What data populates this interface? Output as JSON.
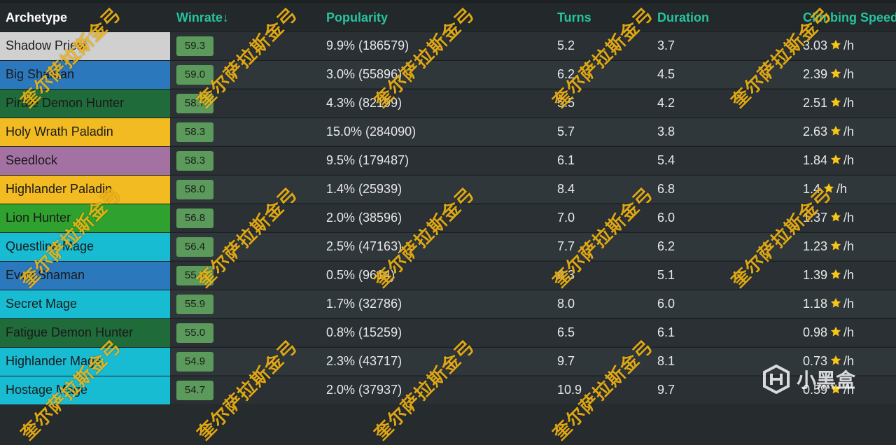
{
  "header": {
    "archetype": "Archetype",
    "winrate": "Winrate↓",
    "popularity": "Popularity",
    "turns": "Turns",
    "duration": "Duration",
    "climbing_speed": "Climbing Speed"
  },
  "rows": [
    {
      "name": "Shadow Priest",
      "color": "#d0d0d0",
      "winrate": "59.3",
      "popularity": "9.9% (186579)",
      "turns": "5.2",
      "duration": "3.7",
      "speed": "3.03",
      "unit": "/h"
    },
    {
      "name": "Big Shaman",
      "color": "#2b78bd",
      "winrate": "59.0",
      "popularity": "3.0% (55896)",
      "turns": "6.2",
      "duration": "4.5",
      "speed": "2.39",
      "unit": "/h"
    },
    {
      "name": "Pirate Demon Hunter",
      "color": "#1f6b3a",
      "winrate": "58.7",
      "popularity": "4.3% (82199)",
      "turns": "5.5",
      "duration": "4.2",
      "speed": "2.51",
      "unit": "/h"
    },
    {
      "name": "Holy Wrath Paladin",
      "color": "#f2bb22",
      "winrate": "58.3",
      "popularity": "15.0% (284090)",
      "turns": "5.7",
      "duration": "3.8",
      "speed": "2.63",
      "unit": "/h"
    },
    {
      "name": "Seedlock",
      "color": "#a471a3",
      "winrate": "58.3",
      "popularity": "9.5% (179487)",
      "turns": "6.1",
      "duration": "5.4",
      "speed": "1.84",
      "unit": "/h"
    },
    {
      "name": "Highlander Paladin",
      "color": "#f2bb22",
      "winrate": "58.0",
      "popularity": "1.4% (25939)",
      "turns": "8.4",
      "duration": "6.8",
      "speed": "1.4",
      "unit": "/h"
    },
    {
      "name": "Lion Hunter",
      "color": "#2ea12e",
      "winrate": "56.8",
      "popularity": "2.0% (38596)",
      "turns": "7.0",
      "duration": "6.0",
      "speed": "1.37",
      "unit": "/h"
    },
    {
      "name": "Questline Mage",
      "color": "#17bcd3",
      "winrate": "56.4",
      "popularity": "2.5% (47163)",
      "turns": "7.7",
      "duration": "6.2",
      "speed": "1.23",
      "unit": "/h"
    },
    {
      "name": "Even Shaman",
      "color": "#2b78bd",
      "winrate": "55.9",
      "popularity": "0.5% (9614)",
      "turns": "6.3",
      "duration": "5.1",
      "speed": "1.39",
      "unit": "/h"
    },
    {
      "name": "Secret Mage",
      "color": "#17bcd3",
      "winrate": "55.9",
      "popularity": "1.7% (32786)",
      "turns": "8.0",
      "duration": "6.0",
      "speed": "1.18",
      "unit": "/h"
    },
    {
      "name": "Fatigue Demon Hunter",
      "color": "#1f6b3a",
      "winrate": "55.0",
      "popularity": "0.8% (15259)",
      "turns": "6.5",
      "duration": "6.1",
      "speed": "0.98",
      "unit": "/h"
    },
    {
      "name": "Highlander Mage",
      "color": "#17bcd3",
      "winrate": "54.9",
      "popularity": "2.3% (43717)",
      "turns": "9.7",
      "duration": "8.1",
      "speed": "0.73",
      "unit": "/h"
    },
    {
      "name": "Hostage Mage",
      "color": "#17bcd3",
      "winrate": "54.7",
      "popularity": "2.0% (37937)",
      "turns": "10.9",
      "duration": "9.7",
      "speed": "0.59",
      "unit": "/h"
    }
  ],
  "watermark": "奎尔萨拉斯金弓",
  "logo": {
    "text": "小黑盒",
    "icon": "heybox-logo-icon"
  },
  "colors": {
    "accent": "#27c3a0",
    "winrate_badge": "#5b9a5b",
    "star": "#f5c518"
  }
}
